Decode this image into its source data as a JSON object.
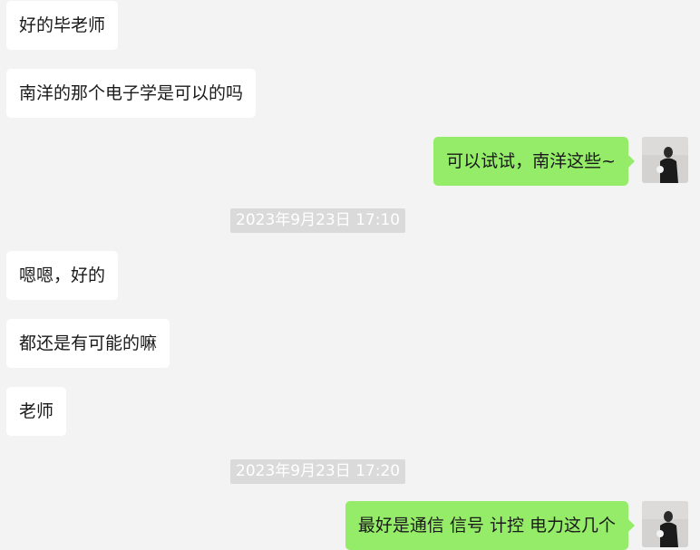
{
  "messages": [
    {
      "side": "in",
      "text": "好的毕老师"
    },
    {
      "side": "in",
      "text": "南洋的那个电子学是可以的吗"
    },
    {
      "side": "out",
      "text": "可以试试，南洋这些~"
    },
    {
      "side": "time",
      "text": "2023年9月23日 17:10"
    },
    {
      "side": "in",
      "text": "嗯嗯，好的"
    },
    {
      "side": "in",
      "text": "都还是有可能的嘛"
    },
    {
      "side": "in",
      "text": "老师"
    },
    {
      "side": "time",
      "text": "2023年9月23日 17:20"
    },
    {
      "side": "out",
      "text": "最好是通信 信号 计控  电力这几个"
    }
  ],
  "colors": {
    "background": "#f3f3f3",
    "incoming_bubble": "#ffffff",
    "outgoing_bubble": "#95ec69",
    "timestamp_bg": "#dadada"
  },
  "icons": {
    "avatar": "user-avatar-icon"
  }
}
